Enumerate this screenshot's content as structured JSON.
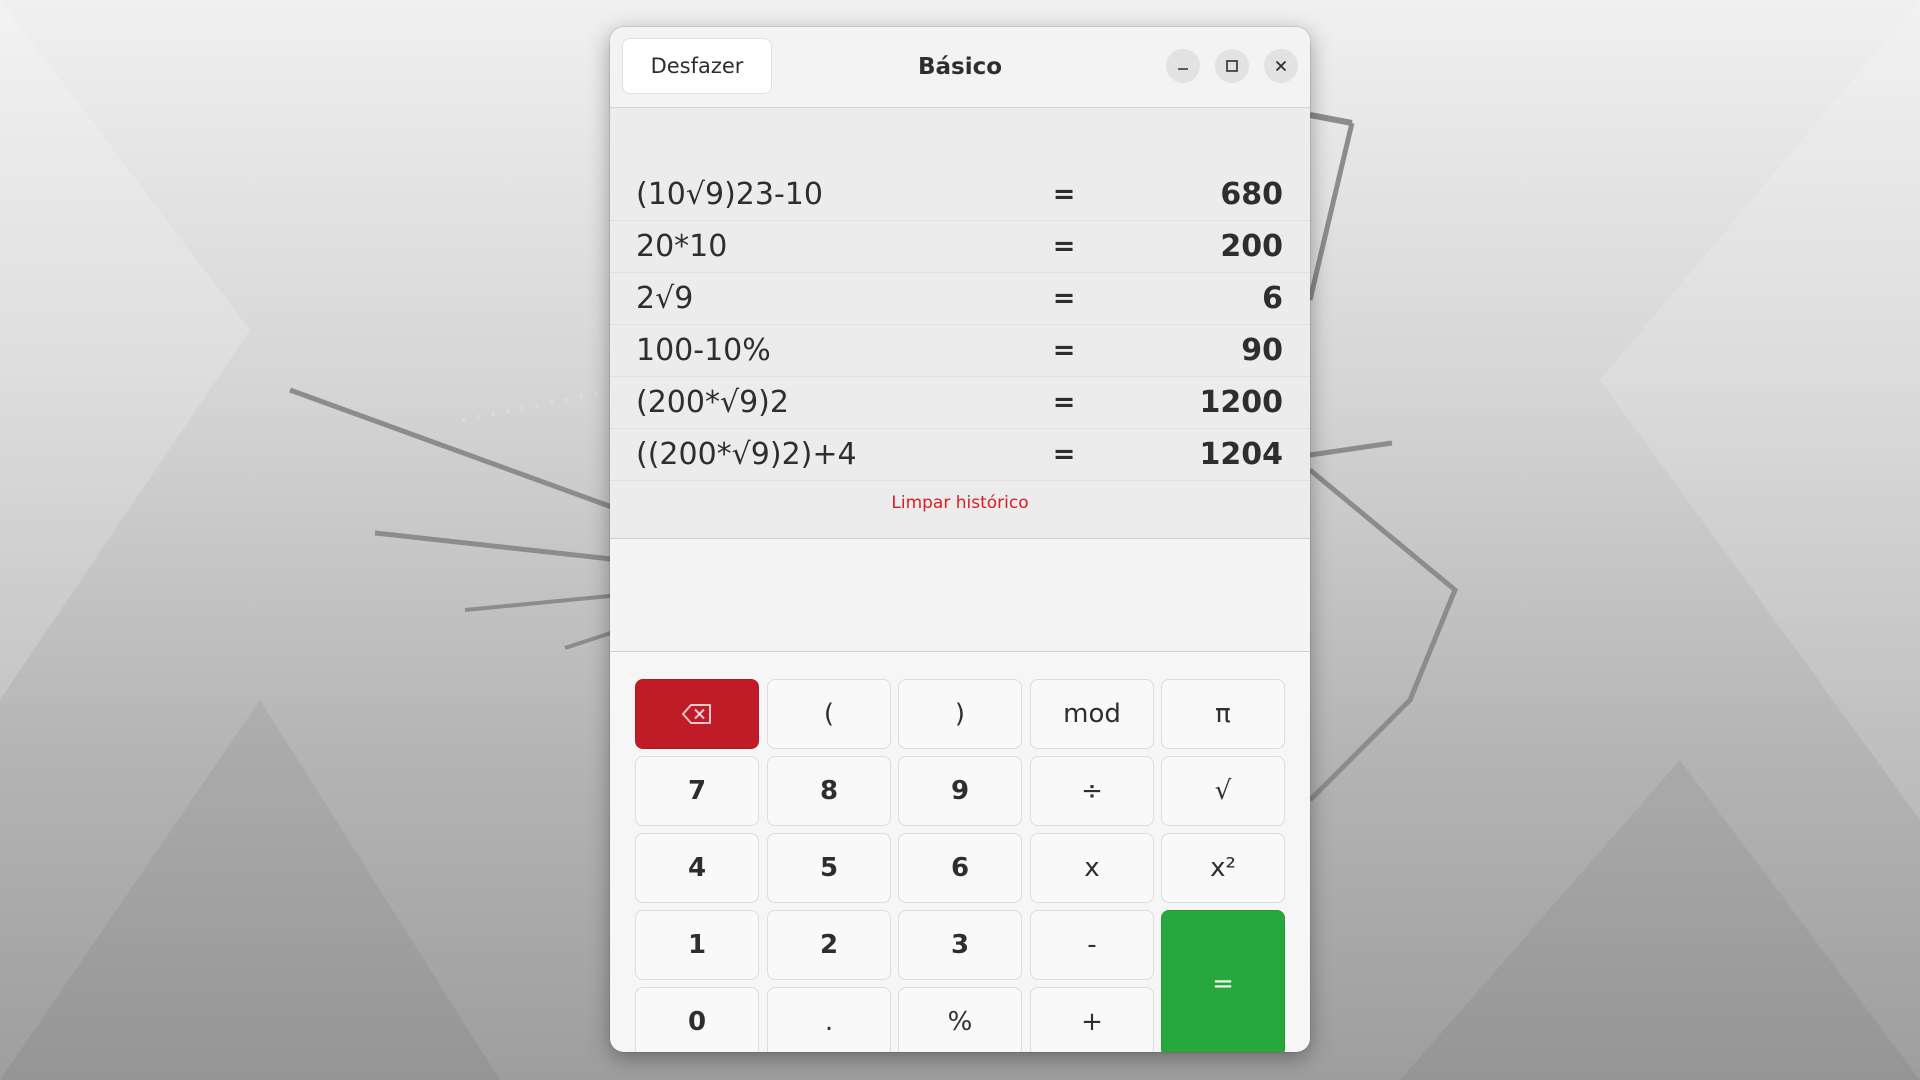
{
  "window": {
    "title": "Básico",
    "undo_label": "Desfazer"
  },
  "history": {
    "rows": [
      {
        "expression": "(10√9)23-10",
        "equals": "=",
        "result": "680"
      },
      {
        "expression": "20*10",
        "equals": "=",
        "result": "200"
      },
      {
        "expression": "2√9",
        "equals": "=",
        "result": "6"
      },
      {
        "expression": "100-10%",
        "equals": "=",
        "result": "90"
      },
      {
        "expression": "(200*√9)2",
        "equals": "=",
        "result": "1200"
      },
      {
        "expression": "((200*√9)2)+4",
        "equals": "=",
        "result": "1204"
      }
    ],
    "clear_label": "Limpar histórico"
  },
  "display": {
    "value": ""
  },
  "keypad": {
    "keys": [
      {
        "label": "",
        "icon": "backspace-icon"
      },
      {
        "label": "("
      },
      {
        "label": ")"
      },
      {
        "label": "mod"
      },
      {
        "label": "π"
      },
      {
        "label": "7"
      },
      {
        "label": "8"
      },
      {
        "label": "9"
      },
      {
        "label": "÷"
      },
      {
        "label": "√"
      },
      {
        "label": "4"
      },
      {
        "label": "5"
      },
      {
        "label": "6"
      },
      {
        "label": "x"
      },
      {
        "label": "x²"
      },
      {
        "label": "1"
      },
      {
        "label": "2"
      },
      {
        "label": "3"
      },
      {
        "label": "-"
      },
      {
        "label": "="
      },
      {
        "label": "0"
      },
      {
        "label": "."
      },
      {
        "label": "%"
      },
      {
        "label": "+"
      }
    ]
  },
  "colors": {
    "accent_destructive": "#c01c28",
    "accent_suggested": "#26a83c",
    "link_destructive": "#e01b24"
  }
}
